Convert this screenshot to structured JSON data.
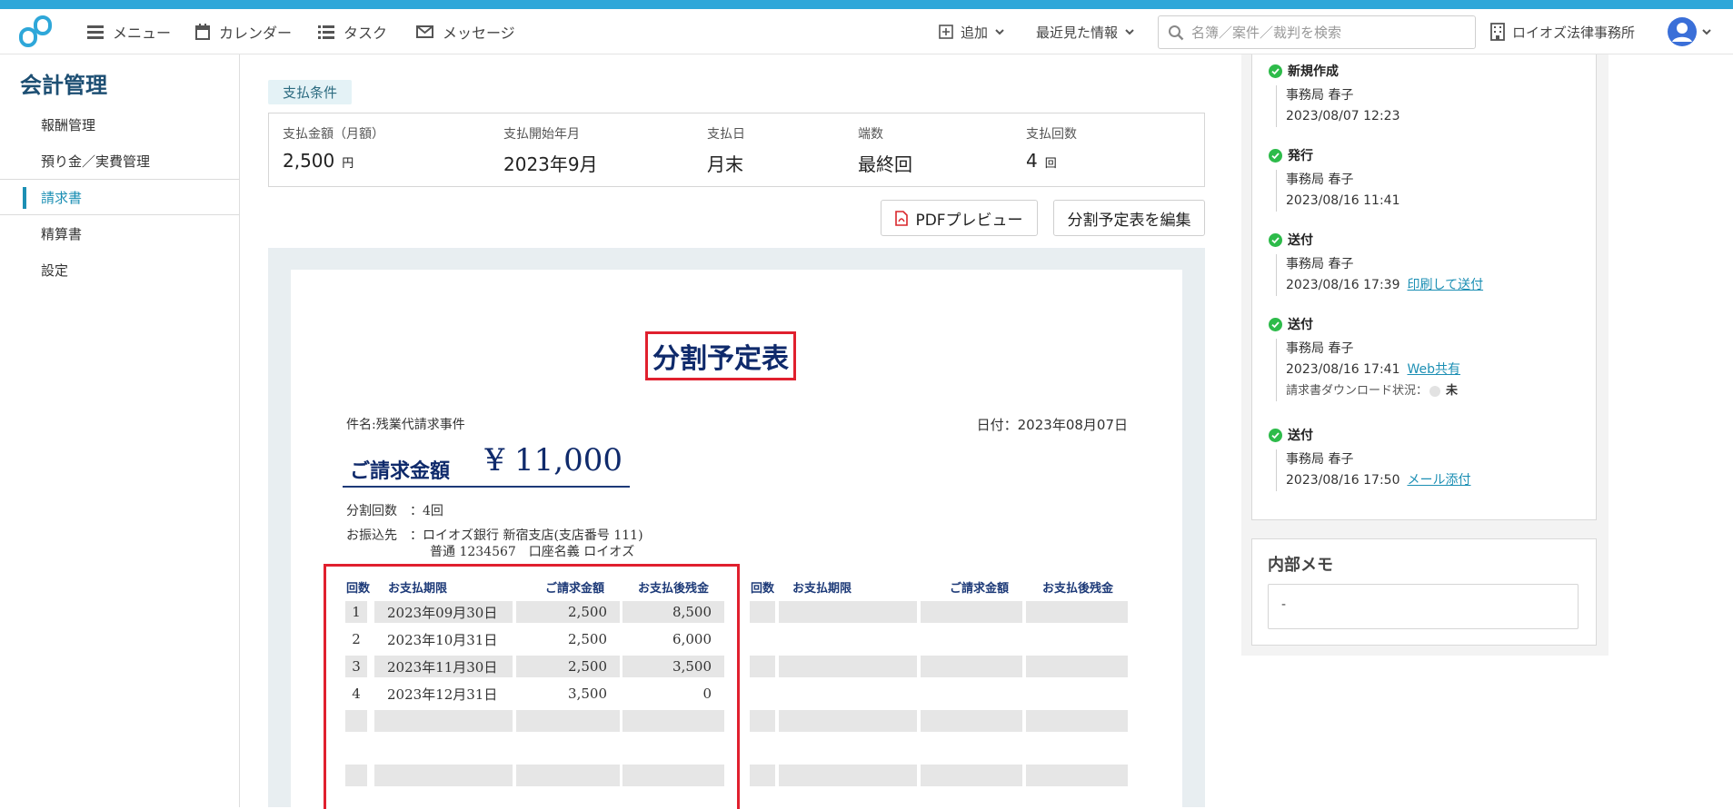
{
  "nav": {
    "menu": "メニュー",
    "calendar": "カレンダー",
    "task": "タスク",
    "message": "メッセージ",
    "add": "追加",
    "recent": "最近見た情報",
    "search_placeholder": "名簿／案件／裁判を検索",
    "office": "ロイオズ法律事務所"
  },
  "sidebar": {
    "title": "会計管理",
    "items": [
      {
        "label": "報酬管理"
      },
      {
        "label": "預り金／実費管理"
      },
      {
        "label": "請求書"
      },
      {
        "label": "精算書"
      },
      {
        "label": "設定"
      }
    ]
  },
  "terms": {
    "badge": "支払条件",
    "amount_label": "支払金額（月額）",
    "amount_value": "2,500",
    "amount_unit": "円",
    "start_label": "支払開始年月",
    "start_value": "2023年9月",
    "day_label": "支払日",
    "day_value": "月末",
    "fraction_label": "端数",
    "fraction_value": "最終回",
    "count_label": "支払回数",
    "count_value": "4",
    "count_unit": "回"
  },
  "buttons": {
    "pdf": "PDFプレビュー",
    "edit": "分割予定表を編集"
  },
  "doc": {
    "title": "分割予定表",
    "case": "件名:残業代請求事件",
    "date": "日付：2023年08月07日",
    "amount_label": "ご請求金額",
    "amount_value": "¥ 11,000",
    "installments": "分割回数　：4回",
    "bank_line1": "お振込先　：ロイオズ銀行 新宿支店(支店番号 111)",
    "bank_line2": "普通 1234567　口座名義 ロイオズ",
    "headers": {
      "no": "回数",
      "due": "お支払期限",
      "billed": "ご請求金額",
      "remain": "お支払後残金"
    },
    "rows": [
      {
        "no": "1",
        "due": "2023年09月30日",
        "billed": "2,500",
        "remain": "8,500"
      },
      {
        "no": "2",
        "due": "2023年10月31日",
        "billed": "2,500",
        "remain": "6,000"
      },
      {
        "no": "3",
        "due": "2023年11月30日",
        "billed": "2,500",
        "remain": "3,500"
      },
      {
        "no": "4",
        "due": "2023年12月31日",
        "billed": "3,500",
        "remain": "0"
      }
    ]
  },
  "history": [
    {
      "action": "新規作成",
      "user": "事務局 春子",
      "time": "2023/08/07 12:23",
      "link": ""
    },
    {
      "action": "発行",
      "user": "事務局 春子",
      "time": "2023/08/16 11:41",
      "link": ""
    },
    {
      "action": "送付",
      "user": "事務局 春子",
      "time": "2023/08/16 17:39",
      "link": "印刷して送付"
    },
    {
      "action": "送付",
      "user": "事務局 春子",
      "time": "2023/08/16 17:41",
      "link": "Web共有",
      "download_label": "請求書ダウンロード状況：",
      "download_status": "未"
    },
    {
      "action": "送付",
      "user": "事務局 春子",
      "time": "2023/08/16 17:50",
      "link": "メール添付"
    }
  ],
  "memo": {
    "title": "内部メモ",
    "value": "-"
  }
}
